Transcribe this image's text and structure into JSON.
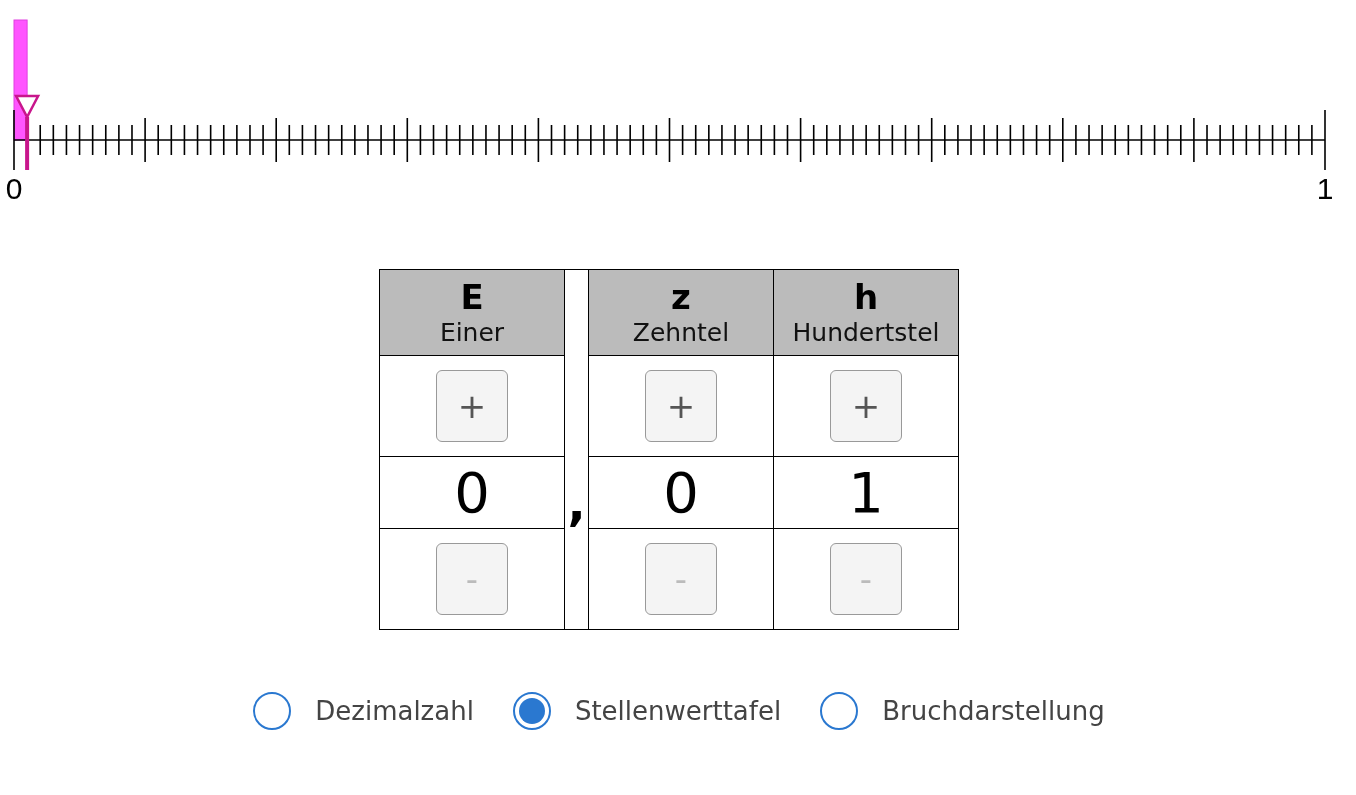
{
  "number_line": {
    "start_label": "0",
    "end_label": "1",
    "level": 0.01
  },
  "place_value_table": {
    "columns": [
      {
        "kind": "digit",
        "symbol": "E",
        "name": "Einer",
        "increment": {
          "label": "+",
          "disabled": false
        },
        "digit": "0",
        "decrement": {
          "label": "-",
          "disabled": true
        }
      },
      {
        "kind": "separator",
        "label": ","
      },
      {
        "kind": "digit",
        "symbol": "z",
        "name": "Zehntel",
        "increment": {
          "label": "+",
          "disabled": false
        },
        "digit": "0",
        "decrement": {
          "label": "-",
          "disabled": true
        }
      },
      {
        "kind": "digit",
        "symbol": "h",
        "name": "Hundertstel",
        "increment": {
          "label": "+",
          "disabled": false
        },
        "digit": "1",
        "decrement": {
          "label": "-",
          "disabled": true
        }
      }
    ]
  },
  "display_modes": [
    {
      "label": "Dezimalzahl",
      "selected": false
    },
    {
      "label": "Stellenwerttafel",
      "selected": true
    },
    {
      "label": "Bruchdarstellung",
      "selected": false
    }
  ]
}
